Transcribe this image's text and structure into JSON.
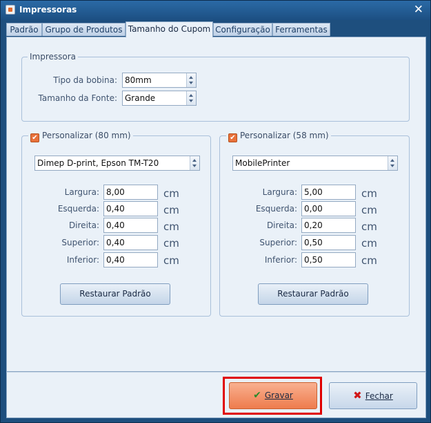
{
  "window": {
    "title": "Impressoras",
    "close_glyph": "✕"
  },
  "tabs": [
    "Padrão",
    "Grupo de Produtos",
    "Tamanho do Cupom",
    "Configuração",
    "Ferramentas"
  ],
  "impressora": {
    "legend": "Impressora",
    "tipo_bobina_label": "Tipo da bobina:",
    "tipo_bobina_value": "80mm",
    "tamanho_fonte_label": "Tamanho da Fonte:",
    "tamanho_fonte_value": "Grande"
  },
  "group80": {
    "legend": "Personalizar (80 mm)",
    "checked": true,
    "printer": "Dimep D-print, Epson TM-T20",
    "fields": [
      {
        "label": "Largura:",
        "value": "8,00",
        "unit": "cm"
      },
      {
        "label": "Esquerda:",
        "value": "0,40",
        "unit": "cm"
      },
      {
        "label": "Direita:",
        "value": "0,40",
        "unit": "cm"
      },
      {
        "label": "Superior:",
        "value": "0,40",
        "unit": "cm"
      },
      {
        "label": "Inferior:",
        "value": "0,40",
        "unit": "cm"
      }
    ],
    "restore_label": "Restaurar Padrão"
  },
  "group58": {
    "legend": "Personalizar (58 mm)",
    "checked": true,
    "printer": "MobilePrinter",
    "fields": [
      {
        "label": "Largura:",
        "value": "5,00",
        "unit": "cm"
      },
      {
        "label": "Esquerda:",
        "value": "0,00",
        "unit": "cm"
      },
      {
        "label": "Direita:",
        "value": "0,20",
        "unit": "cm"
      },
      {
        "label": "Superior:",
        "value": "0,50",
        "unit": "cm"
      },
      {
        "label": "Inferior:",
        "value": "0,50",
        "unit": "cm"
      }
    ],
    "restore_label": "Restaurar Padrão"
  },
  "footer": {
    "save_label": "Gravar",
    "close_label": "Fechar"
  },
  "colors": {
    "accent": "#ee7c4d",
    "highlight": "#e00000",
    "window": "#1e4f7e"
  }
}
